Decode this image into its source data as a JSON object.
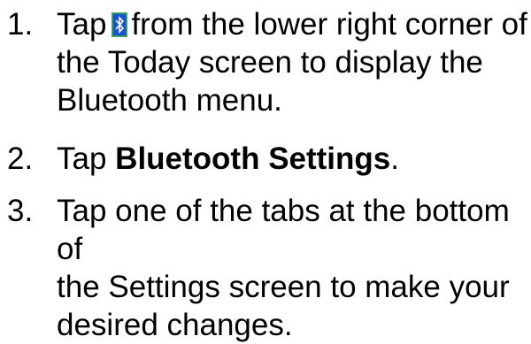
{
  "steps": [
    {
      "number": "1.",
      "line1_before": "Tap",
      "icon": "bluetooth-icon",
      "line1_after": "from the lower right corner of",
      "line2": "the Today screen to display the",
      "line3": "Bluetooth menu."
    },
    {
      "number": "2.",
      "text_before": "Tap",
      "bold": "Bluetooth Settings",
      "text_after": "."
    },
    {
      "number": "3.",
      "line1": "Tap one of the tabs at the bottom of",
      "line2": "the Settings screen to make your",
      "line3": "desired changes."
    }
  ],
  "colors": {
    "text": "#000000",
    "icon_background": "#1a50e0",
    "icon_border": "#3dbf2e",
    "icon_symbol": "#ffffff"
  }
}
